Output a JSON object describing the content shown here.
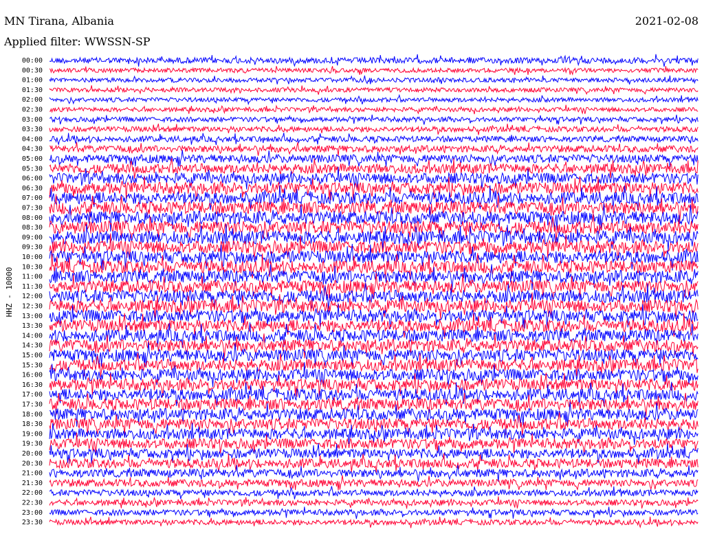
{
  "header": {
    "station": "MN Tirana, Albania",
    "date": "2021-02-08",
    "filter": "Applied filter: WWSSN-SP"
  },
  "chart_data": {
    "type": "line",
    "title": "MN Tirana, Albania",
    "subtitle": "Applied filter: WWSSN-SP",
    "ylabel": "HHZ - 10000",
    "tick_labels": [
      "00:00",
      "00:30",
      "01:00",
      "01:30",
      "02:00",
      "02:30",
      "03:00",
      "03:30",
      "04:00",
      "04:30",
      "05:00",
      "05:30",
      "06:00",
      "06:30",
      "07:00",
      "07:30",
      "08:00",
      "08:30",
      "09:00",
      "09:30",
      "10:00",
      "10:30",
      "11:00",
      "11:30",
      "12:00",
      "12:30",
      "13:00",
      "13:30",
      "14:00",
      "14:30",
      "15:00",
      "15:30",
      "16:00",
      "16:30",
      "17:00",
      "17:30",
      "18:00",
      "18:30",
      "19:00",
      "19:30",
      "20:00",
      "20:30",
      "21:00",
      "21:30",
      "22:00",
      "22:30",
      "23:00",
      "23:30"
    ],
    "trace_colors": [
      "#0000ff",
      "#ff0033"
    ],
    "relative_amplitude": [
      0.6,
      0.45,
      0.45,
      0.45,
      0.45,
      0.45,
      0.5,
      0.55,
      0.6,
      0.7,
      0.85,
      1.0,
      1.1,
      1.2,
      1.25,
      1.3,
      1.35,
      1.35,
      1.35,
      1.3,
      1.3,
      1.3,
      1.3,
      1.3,
      1.3,
      1.3,
      1.25,
      1.25,
      1.25,
      1.25,
      1.25,
      1.2,
      1.2,
      1.2,
      1.2,
      1.2,
      1.2,
      1.15,
      1.1,
      1.05,
      1.0,
      0.95,
      0.85,
      0.75,
      0.65,
      0.6,
      0.6,
      0.55
    ],
    "grid": false
  }
}
